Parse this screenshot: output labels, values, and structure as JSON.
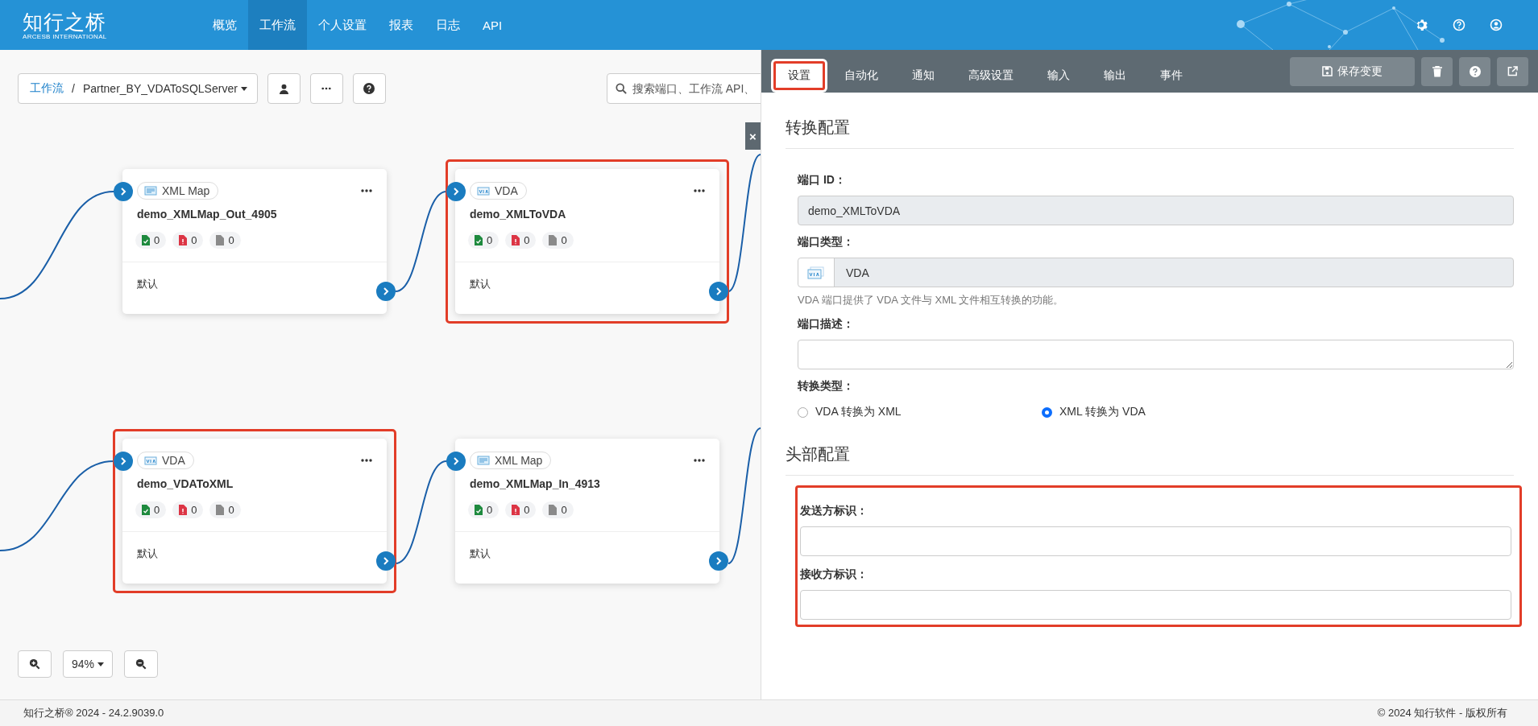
{
  "header": {
    "logo": "知行之桥",
    "logo_subtitle": "ARCESB INTERNATIONAL",
    "nav": [
      {
        "label": "概览",
        "selected": false
      },
      {
        "label": "工作流",
        "selected": true
      },
      {
        "label": "个人设置",
        "selected": false
      },
      {
        "label": "报表",
        "selected": false
      },
      {
        "label": "日志",
        "selected": false
      },
      {
        "label": "API",
        "selected": false
      }
    ]
  },
  "toolbar": {
    "breadcrumb_root": "工作流",
    "separator": "/",
    "workflow": "Partner_BY_VDAToSQLServer",
    "search_placeholder": "搜索端口、工作流 API、"
  },
  "close_label": "×",
  "nodes": [
    {
      "kind": "xml-map",
      "type_label": "XML Map",
      "name": "demo_XMLMap_Out_4905",
      "highlighted": false,
      "counts": [
        {
          "kind": "success",
          "count": "0"
        },
        {
          "kind": "error",
          "count": "0"
        },
        {
          "kind": "pending",
          "count": "0"
        }
      ],
      "output_label": "默认"
    },
    {
      "kind": "vda",
      "type_label": "VDA",
      "name": "demo_XMLToVDA",
      "highlighted": true,
      "counts": [
        {
          "kind": "success",
          "count": "0"
        },
        {
          "kind": "error",
          "count": "0"
        },
        {
          "kind": "pending",
          "count": "0"
        }
      ],
      "output_label": "默认"
    },
    {
      "kind": "vda",
      "type_label": "VDA",
      "name": "demo_VDAToXML",
      "highlighted": true,
      "counts": [
        {
          "kind": "success",
          "count": "0"
        },
        {
          "kind": "error",
          "count": "0"
        },
        {
          "kind": "pending",
          "count": "0"
        }
      ],
      "output_label": "默认"
    },
    {
      "kind": "xml-map",
      "type_label": "XML Map",
      "name": "demo_XMLMap_In_4913",
      "highlighted": false,
      "counts": [
        {
          "kind": "success",
          "count": "0"
        },
        {
          "kind": "error",
          "count": "0"
        },
        {
          "kind": "pending",
          "count": "0"
        }
      ],
      "output_label": "默认"
    }
  ],
  "zoom": {
    "level": "94%"
  },
  "panel": {
    "tabs": [
      {
        "label": "设置",
        "selected": true,
        "highlighted": true
      },
      {
        "label": "自动化",
        "selected": false,
        "highlighted": false
      },
      {
        "label": "通知",
        "selected": false,
        "highlighted": false
      },
      {
        "label": "高级设置",
        "selected": false,
        "highlighted": false
      },
      {
        "label": "输入",
        "selected": false,
        "highlighted": false
      },
      {
        "label": "输出",
        "selected": false,
        "highlighted": false
      },
      {
        "label": "事件",
        "selected": false,
        "highlighted": false
      }
    ],
    "save_label": "保存变更",
    "conversion": {
      "title": "转换配置",
      "port_id": {
        "label": "端口 ID：",
        "value": "demo_XMLToVDA"
      },
      "port_type": {
        "label": "端口类型：",
        "value": "VDA",
        "help": "VDA 端口提供了 VDA 文件与 XML 文件相互转换的功能。"
      },
      "description": {
        "label": "端口描述："
      },
      "conversion_type": {
        "label": "转换类型：",
        "options": [
          {
            "label": "VDA 转换为 XML",
            "selected": false
          },
          {
            "label": "XML 转换为 VDA",
            "selected": true
          }
        ]
      }
    },
    "header_config": {
      "title": "头部配置",
      "highlighted": true,
      "fields": [
        {
          "label": "发送方标识："
        },
        {
          "label": "接收方标识："
        }
      ]
    }
  },
  "footer": {
    "left": "知行之桥® 2024 - 24.2.9039.0",
    "right": "© 2024 知行软件 - 版权所有"
  }
}
